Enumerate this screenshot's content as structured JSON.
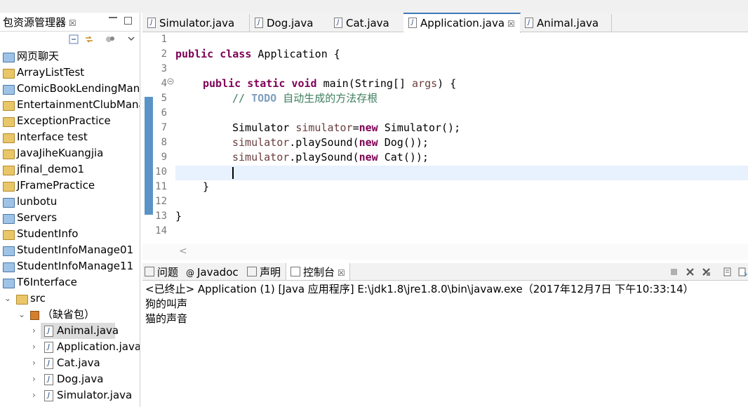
{
  "explorer": {
    "title": "包资源管理器",
    "close": "☒",
    "items": [
      {
        "label": "网页聊天",
        "icon": "folder"
      },
      {
        "label": "ArrayListTest",
        "icon": "java-project"
      },
      {
        "label": "ComicBookLendingMan",
        "icon": "folder"
      },
      {
        "label": "EntertainmentClubMana",
        "icon": "java-project"
      },
      {
        "label": "ExceptionPractice",
        "icon": "java-project"
      },
      {
        "label": "Interface test",
        "icon": "java-project"
      },
      {
        "label": "JavaJiheKuangjia",
        "icon": "java-project"
      },
      {
        "label": "jfinal_demo1",
        "icon": "java-project"
      },
      {
        "label": "JFramePractice",
        "icon": "java-project"
      },
      {
        "label": "lunbotu",
        "icon": "folder"
      },
      {
        "label": "Servers",
        "icon": "folder"
      },
      {
        "label": "StudentInfo",
        "icon": "java-project"
      },
      {
        "label": "StudentInfoManage01",
        "icon": "folder"
      },
      {
        "label": "StudentInfoManage11",
        "icon": "folder"
      },
      {
        "label": "T6Interface",
        "icon": "folder"
      },
      {
        "label": "src",
        "icon": "source-folder"
      },
      {
        "label": "（缺省包）",
        "icon": "package"
      },
      {
        "label": "Animal.java",
        "icon": "java-file"
      },
      {
        "label": "Application.java",
        "icon": "java-file"
      },
      {
        "label": "Cat.java",
        "icon": "java-file"
      },
      {
        "label": "Dog.java",
        "icon": "java-file"
      },
      {
        "label": "Simulator.java",
        "icon": "java-file"
      }
    ]
  },
  "editor": {
    "tabs": [
      {
        "label": "Simulator.java"
      },
      {
        "label": "Dog.java"
      },
      {
        "label": "Cat.java"
      },
      {
        "label": "Application.java",
        "active": true
      },
      {
        "label": "Animal.java"
      }
    ],
    "tab_close": "☒",
    "line_numbers": [
      "1",
      "2",
      "3",
      "4",
      "5",
      "6",
      "7",
      "8",
      "9",
      "10",
      "11",
      "12",
      "13",
      "14"
    ],
    "code": {
      "l2_kw": "public class",
      "l2_rest": " Application {",
      "l4_kw": "public static void",
      "l4_rest": " main(String[] ",
      "l4_arg": "args",
      "l4_end": ") {",
      "l5_comment": "// ",
      "l5_todo": "TODO",
      "l5_text": " 自动生成的方法存根",
      "l7_a": "Simulator ",
      "l7_var": "simulator",
      "l7_b": "=",
      "l7_new": "new",
      "l7_c": " Simulator();",
      "l8_var": "simulator",
      "l8_a": ".playSound(",
      "l8_new": "new",
      "l8_b": " Dog());",
      "l9_var": "simulator",
      "l9_a": ".playSound(",
      "l9_new": "new",
      "l9_b": " Cat());",
      "l11": "}",
      "l13": "}"
    },
    "scroll_left_glyph": "<"
  },
  "console": {
    "tabs": [
      {
        "label": "问题"
      },
      {
        "label": "Javadoc"
      },
      {
        "label": "声明"
      },
      {
        "label": "控制台",
        "active": true
      }
    ],
    "tab_close": "☒",
    "status": "<已终止> Application (1) [Java 应用程序] E:\\jdk1.8\\jre1.8.0\\bin\\javaw.exe（2017年12月7日 下午10:33:14）",
    "output": [
      "狗的叫声",
      "猫的声音"
    ]
  }
}
